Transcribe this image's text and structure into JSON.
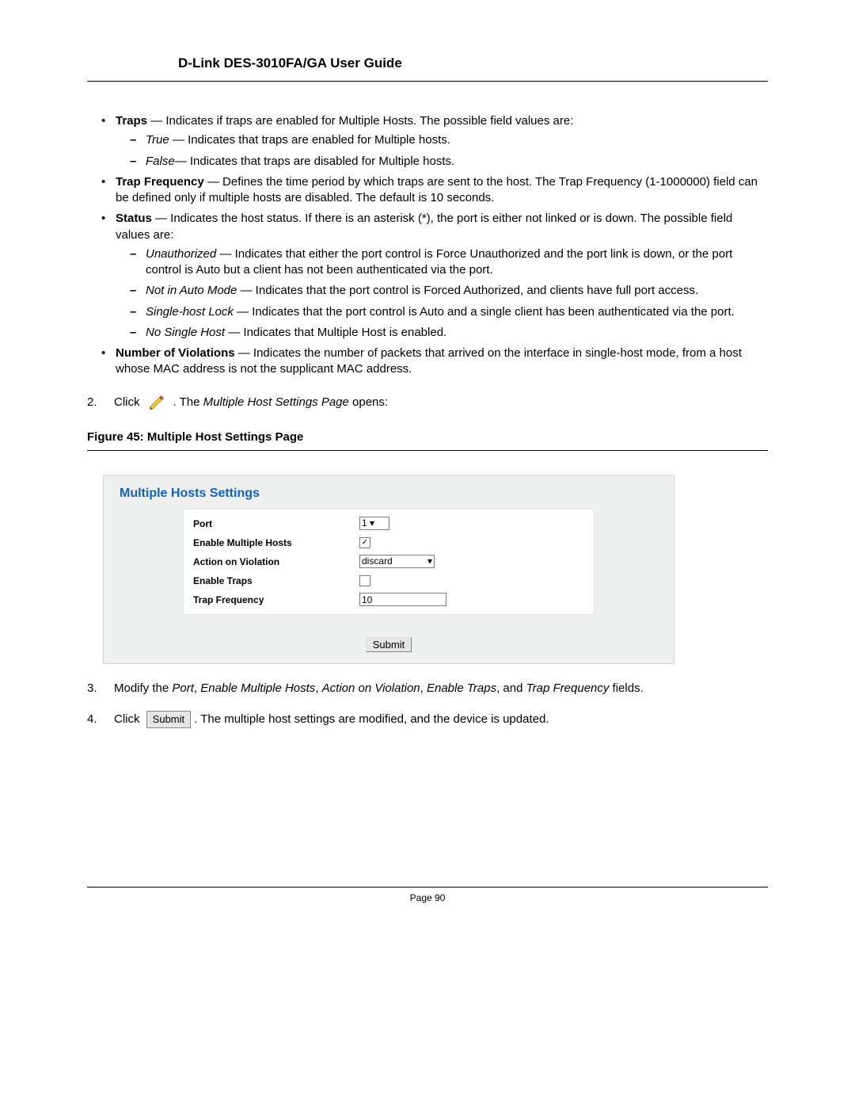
{
  "header": {
    "title": "D-Link DES-3010FA/GA User Guide"
  },
  "bullets": {
    "traps": {
      "term": "Traps",
      "desc": " — Indicates if traps are enabled for Multiple Hosts. The possible field values are:",
      "true_term": "True",
      "true_desc": " — Indicates that traps are enabled for Multiple hosts.",
      "false_term": "False",
      "false_desc": "— Indicates that traps are disabled for Multiple hosts."
    },
    "trapfreq": {
      "term": "Trap Frequency",
      "desc": " — Defines the time period by which traps are sent to the host. The Trap Frequency (1-1000000) field can be defined only if multiple hosts are disabled. The default is 10 seconds."
    },
    "status": {
      "term": "Status",
      "desc": " — Indicates the host status. If there is an asterisk (*), the port is either not linked or is down. The possible field values are:",
      "unauth_term": "Unauthorized",
      "unauth_desc": " — Indicates that either the port control is Force Unauthorized and the port link is down, or the port control is Auto but a client has not been authenticated via the port.",
      "notauto_term": "Not in Auto Mode",
      "notauto_desc": " — Indicates that the port control is Forced Authorized, and clients have full port access.",
      "single_term": "Single-host Lock",
      "single_desc": " — Indicates that the port control is Auto and a single client has been authenticated via the port.",
      "nosingle_term": "No Single Host",
      "nosingle_desc": " — Indicates that Multiple Host is enabled."
    },
    "violations": {
      "term": "Number of Violations",
      "desc": " — Indicates the number of packets that arrived on the interface in single-host mode, from a host whose MAC address is not the supplicant MAC address."
    }
  },
  "step2": {
    "num": "2.",
    "click": "Click",
    "after_icon_pre": ". The ",
    "page_name": "Multiple Host Settings Page",
    "after_icon_post": " opens:"
  },
  "figure": {
    "caption": "Figure 45:  Multiple Host Settings Page"
  },
  "panel": {
    "title": "Multiple Hosts Settings",
    "labels": {
      "port": "Port",
      "enable_mh": "Enable Multiple Hosts",
      "action": "Action on Violation",
      "enable_traps": "Enable Traps",
      "trap_freq": "Trap Frequency"
    },
    "values": {
      "port": "1",
      "enable_mh_checked": "✓",
      "action": "discard",
      "enable_traps_checked": "",
      "trap_freq": "10"
    },
    "submit": "Submit"
  },
  "step3": {
    "num": "3.",
    "pre": "Modify the ",
    "f1": "Port",
    "c1": ", ",
    "f2": "Enable Multiple Hosts",
    "c2": ", ",
    "f3": "Action on Violation",
    "c3": ", ",
    "f4": "Enable Traps",
    "c4": ", and ",
    "f5": "Trap Frequency",
    "post": " fields."
  },
  "step4": {
    "num": "4.",
    "click": "Click",
    "btn": "Submit",
    "after": ". The multiple host settings are modified, and the device is updated."
  },
  "footer": {
    "text": "Page 90"
  }
}
